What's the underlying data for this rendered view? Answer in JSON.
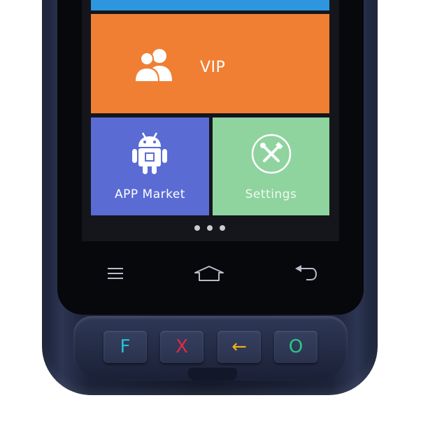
{
  "screen": {
    "tiles": {
      "vip": {
        "label": "VIP",
        "icon": "users-icon",
        "color": "#f07f34"
      },
      "app_market": {
        "label": "APP Market",
        "icon": "android-icon",
        "color": "#5a6bd4"
      },
      "settings": {
        "label": "Settings",
        "icon": "tools-icon",
        "color": "#8fd39f"
      }
    },
    "page_dots": 3
  },
  "navbar": {
    "menu_icon": "menu-icon",
    "home_icon": "home-icon",
    "back_icon": "back-icon"
  },
  "keypad": {
    "keys": [
      {
        "label": "F",
        "color": "#22c3d8"
      },
      {
        "label": "X",
        "color": "#e02a4a"
      },
      {
        "label": "←",
        "color": "#f0b21c"
      },
      {
        "label": "O",
        "color": "#28c88a"
      }
    ]
  }
}
